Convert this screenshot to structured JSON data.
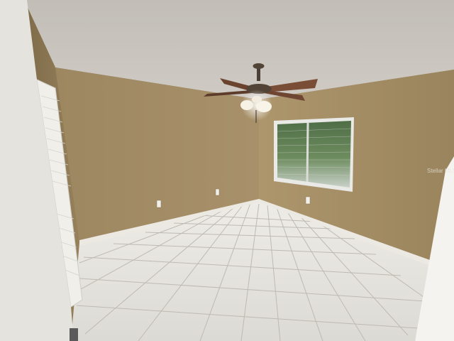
{
  "scene": {
    "subject": "empty-bedroom-interior",
    "watermark": "Stellar MLS",
    "colors": {
      "ceiling": "#c9c4be",
      "wall_back": "#a38c62",
      "wall_right": "#a48c63",
      "wall_left": "#8f7b56",
      "floor": "#e6e4de",
      "grout": "#b9b6ae",
      "baseboard": "#ece9e2",
      "door": "#f0efea",
      "fan_blade": "#7a4e36",
      "fan_light": "#f4f0e4",
      "window_frame": "#e9e9e6",
      "foliage": "#5c7a52"
    }
  }
}
